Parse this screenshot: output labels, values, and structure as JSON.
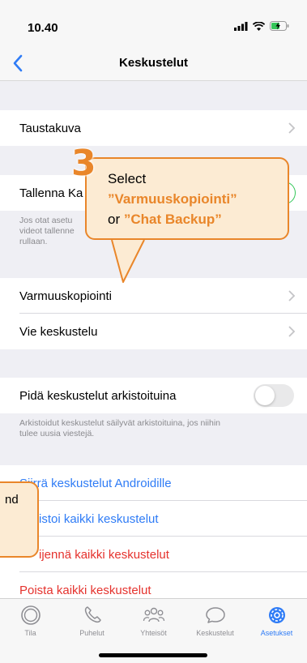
{
  "status_bar": {
    "time": "10.40"
  },
  "nav": {
    "title": "Keskustelut"
  },
  "rows": {
    "wallpaper": "Taustakuva",
    "save_to_camera": "Tallenna Ka",
    "save_footnote": [
      "Jos otat asetu",
      "videot tallenne",
      "rullaan."
    ],
    "backup": "Varmuuskopiointi",
    "export": "Vie keskustelu",
    "keep_archived": "Pidä keskustelut arkistoituina",
    "archived_footnote": [
      "Arkistoidut keskustelut säilyvät arkistoituina, jos niihin",
      "tulee uusia viestejä."
    ],
    "move_android": "Siirrä keskustelut Androidille",
    "archive_all": "istoi kaikki keskustelut",
    "clear_all": "ijennä kaikki keskustelut",
    "delete_all": "Poista kaikki keskustelut"
  },
  "toggles": {
    "keep_archived": false,
    "save_to_camera": true
  },
  "tabs": [
    {
      "label": "Tila",
      "icon": "status-icon"
    },
    {
      "label": "Puhelut",
      "icon": "phone-icon"
    },
    {
      "label": "Yhteisöt",
      "icon": "communities-icon"
    },
    {
      "label": "Keskustelut",
      "icon": "chats-icon"
    },
    {
      "label": "Asetukset",
      "icon": "settings-icon",
      "active": true
    }
  ],
  "callout": {
    "step": "3",
    "line1": "Select",
    "line2": "”Varmuuskopiointi”",
    "line3_prefix": "or ",
    "line3_accent": "”Chat Backup”"
  },
  "callout2": {
    "text": "nd"
  },
  "colors": {
    "accent_blue": "#2f7cf6",
    "destructive_red": "#e5322d",
    "callout_orange": "#e9862a",
    "callout_fill": "#fcebd3",
    "toggle_green": "#34c759"
  }
}
